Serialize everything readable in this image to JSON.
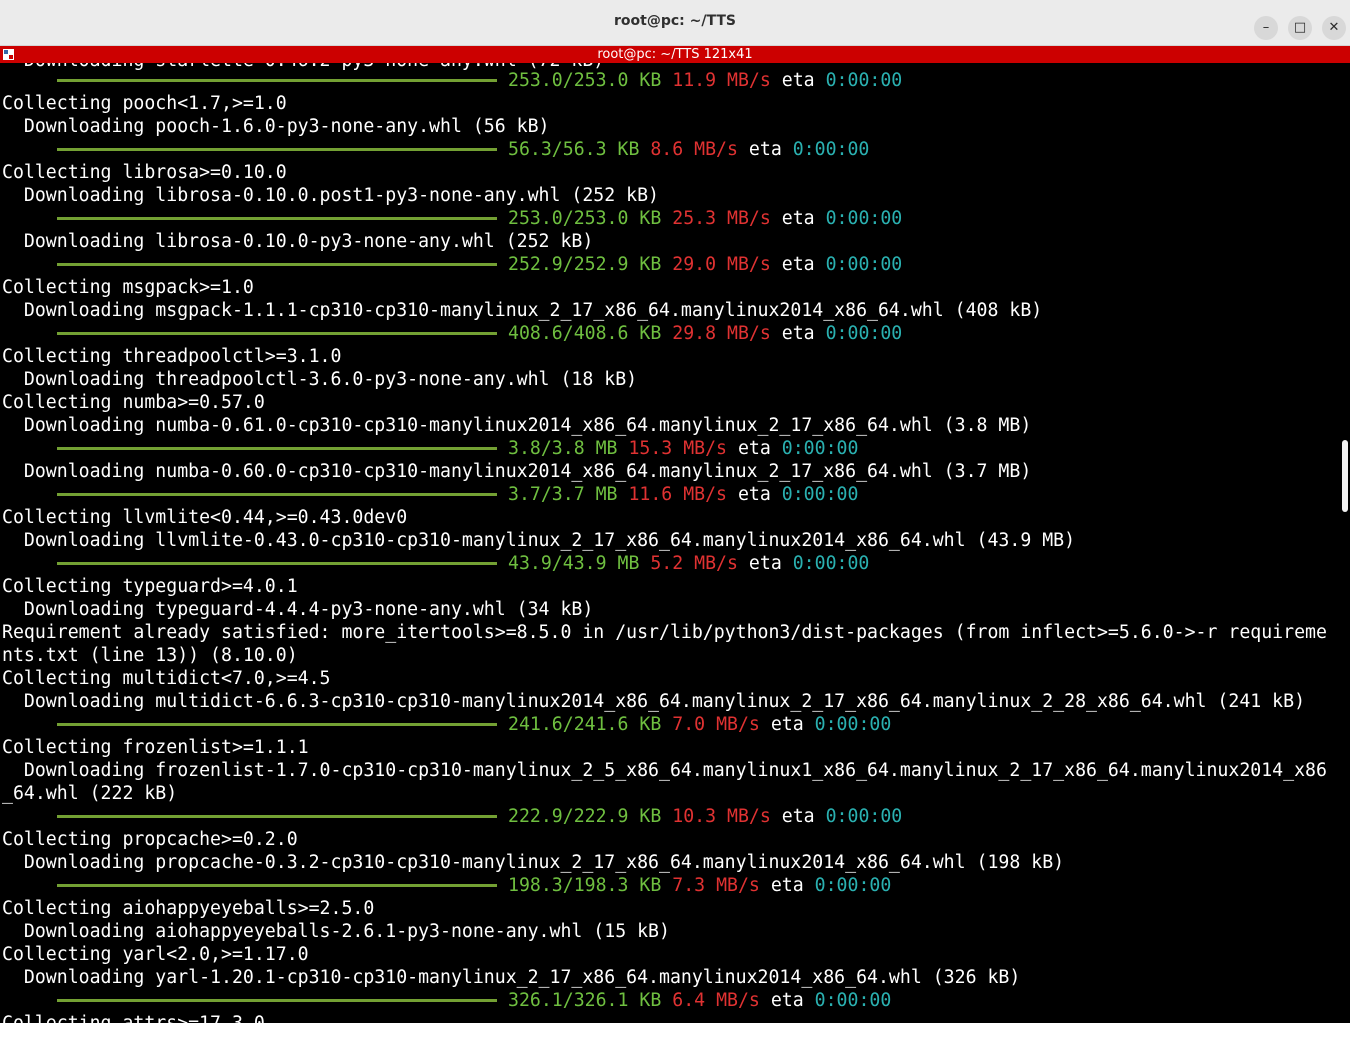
{
  "window": {
    "title": "root@pc: ~/TTS",
    "min_glyph": "–",
    "max_glyph": "□",
    "close_glyph": "✕"
  },
  "tmux": {
    "title": "root@pc: ~/TTS 121x41"
  },
  "colors": {
    "terminal_bg": "#000000",
    "progress_bar": "#73a033",
    "progress_text": "#6fbf40",
    "speed_text": "#e03232",
    "eta_text": "#2ab0b0",
    "tmux_bar": "#cc0000"
  },
  "lines": [
    {
      "type": "progress",
      "size": "253.0/253.0 KB",
      "speed": "11.9 MB/s",
      "eta_label": "eta",
      "eta": "0:00:00"
    },
    {
      "type": "text",
      "text": "Collecting pooch<1.7,>=1.0"
    },
    {
      "type": "text",
      "text": "  Downloading pooch-1.6.0-py3-none-any.whl (56 kB)"
    },
    {
      "type": "progress",
      "size": "56.3/56.3 KB",
      "speed": "8.6 MB/s",
      "eta_label": "eta",
      "eta": "0:00:00"
    },
    {
      "type": "text",
      "text": "Collecting librosa>=0.10.0"
    },
    {
      "type": "text",
      "text": "  Downloading librosa-0.10.0.post1-py3-none-any.whl (252 kB)"
    },
    {
      "type": "progress",
      "size": "253.0/253.0 KB",
      "speed": "25.3 MB/s",
      "eta_label": "eta",
      "eta": "0:00:00"
    },
    {
      "type": "text",
      "text": "  Downloading librosa-0.10.0-py3-none-any.whl (252 kB)"
    },
    {
      "type": "progress",
      "size": "252.9/252.9 KB",
      "speed": "29.0 MB/s",
      "eta_label": "eta",
      "eta": "0:00:00"
    },
    {
      "type": "text",
      "text": "Collecting msgpack>=1.0"
    },
    {
      "type": "text",
      "text": "  Downloading msgpack-1.1.1-cp310-cp310-manylinux_2_17_x86_64.manylinux2014_x86_64.whl (408 kB)"
    },
    {
      "type": "progress",
      "size": "408.6/408.6 KB",
      "speed": "29.8 MB/s",
      "eta_label": "eta",
      "eta": "0:00:00"
    },
    {
      "type": "text",
      "text": "Collecting threadpoolctl>=3.1.0"
    },
    {
      "type": "text",
      "text": "  Downloading threadpoolctl-3.6.0-py3-none-any.whl (18 kB)"
    },
    {
      "type": "text",
      "text": "Collecting numba>=0.57.0"
    },
    {
      "type": "text",
      "text": "  Downloading numba-0.61.0-cp310-cp310-manylinux2014_x86_64.manylinux_2_17_x86_64.whl (3.8 MB)"
    },
    {
      "type": "progress",
      "size": "3.8/3.8 MB",
      "speed": "15.3 MB/s",
      "eta_label": "eta",
      "eta": "0:00:00"
    },
    {
      "type": "text",
      "text": "  Downloading numba-0.60.0-cp310-cp310-manylinux2014_x86_64.manylinux_2_17_x86_64.whl (3.7 MB)"
    },
    {
      "type": "progress",
      "size": "3.7/3.7 MB",
      "speed": "11.6 MB/s",
      "eta_label": "eta",
      "eta": "0:00:00"
    },
    {
      "type": "text",
      "text": "Collecting llvmlite<0.44,>=0.43.0dev0"
    },
    {
      "type": "text",
      "text": "  Downloading llvmlite-0.43.0-cp310-cp310-manylinux_2_17_x86_64.manylinux2014_x86_64.whl (43.9 MB)"
    },
    {
      "type": "progress",
      "size": "43.9/43.9 MB",
      "speed": "5.2 MB/s",
      "eta_label": "eta",
      "eta": "0:00:00"
    },
    {
      "type": "text",
      "text": "Collecting typeguard>=4.0.1"
    },
    {
      "type": "text",
      "text": "  Downloading typeguard-4.4.4-py3-none-any.whl (34 kB)"
    },
    {
      "type": "text",
      "text": "Requirement already satisfied: more_itertools>=8.5.0 in /usr/lib/python3/dist-packages (from inflect>=5.6.0->-r requireme"
    },
    {
      "type": "text",
      "text": "nts.txt (line 13)) (8.10.0)"
    },
    {
      "type": "text",
      "text": "Collecting multidict<7.0,>=4.5"
    },
    {
      "type": "text",
      "text": "  Downloading multidict-6.6.3-cp310-cp310-manylinux2014_x86_64.manylinux_2_17_x86_64.manylinux_2_28_x86_64.whl (241 kB)"
    },
    {
      "type": "progress",
      "size": "241.6/241.6 KB",
      "speed": "7.0 MB/s",
      "eta_label": "eta",
      "eta": "0:00:00"
    },
    {
      "type": "text",
      "text": "Collecting frozenlist>=1.1.1"
    },
    {
      "type": "text",
      "text": "  Downloading frozenlist-1.7.0-cp310-cp310-manylinux_2_5_x86_64.manylinux1_x86_64.manylinux_2_17_x86_64.manylinux2014_x86"
    },
    {
      "type": "text",
      "text": "_64.whl (222 kB)"
    },
    {
      "type": "progress",
      "size": "222.9/222.9 KB",
      "speed": "10.3 MB/s",
      "eta_label": "eta",
      "eta": "0:00:00"
    },
    {
      "type": "text",
      "text": "Collecting propcache>=0.2.0"
    },
    {
      "type": "text",
      "text": "  Downloading propcache-0.3.2-cp310-cp310-manylinux_2_17_x86_64.manylinux2014_x86_64.whl (198 kB)"
    },
    {
      "type": "progress",
      "size": "198.3/198.3 KB",
      "speed": "7.3 MB/s",
      "eta_label": "eta",
      "eta": "0:00:00"
    },
    {
      "type": "text",
      "text": "Collecting aiohappyeyeballs>=2.5.0"
    },
    {
      "type": "text",
      "text": "  Downloading aiohappyeyeballs-2.6.1-py3-none-any.whl (15 kB)"
    },
    {
      "type": "text",
      "text": "Collecting yarl<2.0,>=1.17.0"
    },
    {
      "type": "text",
      "text": "  Downloading yarl-1.20.1-cp310-cp310-manylinux_2_17_x86_64.manylinux2014_x86_64.whl (326 kB)"
    },
    {
      "type": "progress",
      "size": "326.1/326.1 KB",
      "speed": "6.4 MB/s",
      "eta_label": "eta",
      "eta": "0:00:00"
    }
  ]
}
